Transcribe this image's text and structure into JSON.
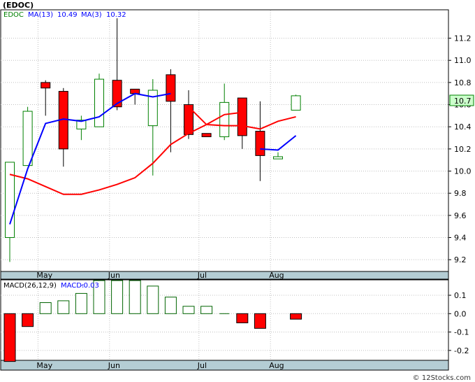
{
  "page": {
    "title": "(EDOC)",
    "footer": "© 12Stocks.com"
  },
  "colors": {
    "up_fill": "#ffffff",
    "up_stroke": "#008000",
    "down_fill": "#ff0000",
    "ma13": "#0000ff",
    "ma3": "#ff0000",
    "macd_pos_stroke": "#006400",
    "macd_neg_fill": "#ff0000",
    "axis_band": "#b4cdd4",
    "last_price_bg": "#ccffcc"
  },
  "chart_data": [
    {
      "type": "candlestick",
      "legend": {
        "ticker": "EDOC",
        "ma13_label": "MA(13)",
        "ma13_value": "10.49",
        "ma3_label": "MA(3)",
        "ma3_value": "10.32"
      },
      "ylim": [
        9.1,
        11.45
      ],
      "yticks": [
        "9.2",
        "9.4",
        "9.6",
        "9.8",
        "10.0",
        "10.2",
        "10.4",
        "10.6",
        "10.8",
        "11.0",
        "11.2"
      ],
      "last_price": "10.7",
      "x_labels": [
        {
          "label": "May",
          "index": 1
        },
        {
          "label": "Jun",
          "index": 5
        },
        {
          "label": "Jul",
          "index": 10
        },
        {
          "label": "Aug",
          "index": 14
        }
      ],
      "candles": [
        {
          "open": 9.4,
          "high": 10.08,
          "low": 9.18,
          "close": 10.08
        },
        {
          "open": 10.05,
          "high": 10.58,
          "low": 10.05,
          "close": 10.54
        },
        {
          "open": 10.8,
          "high": 10.82,
          "low": 10.5,
          "close": 10.75
        },
        {
          "open": 10.72,
          "high": 10.75,
          "low": 10.04,
          "close": 10.2
        },
        {
          "open": 10.38,
          "high": 10.5,
          "low": 10.28,
          "close": 10.46
        },
        {
          "open": 10.4,
          "high": 10.88,
          "low": 10.4,
          "close": 10.83
        },
        {
          "open": 10.82,
          "high": 11.38,
          "low": 10.55,
          "close": 10.58
        },
        {
          "open": 10.74,
          "high": 10.74,
          "low": 10.6,
          "close": 10.7
        },
        {
          "open": 10.41,
          "high": 10.83,
          "low": 9.96,
          "close": 10.73
        },
        {
          "open": 10.87,
          "high": 10.92,
          "low": 10.17,
          "close": 10.63
        },
        {
          "open": 10.6,
          "high": 10.73,
          "low": 10.29,
          "close": 10.33
        },
        {
          "open": 10.34,
          "high": 10.34,
          "low": 10.31,
          "close": 10.31
        },
        {
          "open": 10.31,
          "high": 10.79,
          "low": 10.28,
          "close": 10.62
        },
        {
          "open": 10.66,
          "high": 10.66,
          "low": 10.2,
          "close": 10.32
        },
        {
          "open": 10.36,
          "high": 10.63,
          "low": 9.91,
          "close": 10.14
        },
        {
          "open": 10.11,
          "high": 10.17,
          "low": 10.11,
          "close": 10.13
        },
        {
          "open": 10.55,
          "high": 10.69,
          "low": 10.55,
          "close": 10.68
        }
      ],
      "ma13": [
        9.52,
        10.02,
        10.43,
        10.47,
        10.45,
        10.49,
        10.61,
        10.7,
        10.67,
        10.7,
        null,
        null,
        null,
        null,
        null,
        null,
        null
      ],
      "ma13_tail": [
        null,
        null,
        null,
        null,
        null,
        null,
        null,
        null,
        null,
        null,
        10.58,
        10.42,
        10.41,
        10.41,
        10.38,
        10.45,
        10.49
      ],
      "ma3": [
        9.97,
        9.93,
        9.86,
        9.79,
        9.79,
        9.83,
        9.88,
        9.94,
        10.07,
        10.24,
        10.34,
        10.42,
        10.51,
        10.53,
        null,
        null,
        null
      ],
      "ma3_tail": [
        null,
        null,
        null,
        null,
        null,
        null,
        null,
        null,
        null,
        null,
        null,
        null,
        null,
        null,
        10.2,
        10.19,
        10.32
      ]
    },
    {
      "type": "bar",
      "legend": {
        "label": "MACD(26,12,9)",
        "value_label": "MACD:",
        "value": "-0.03"
      },
      "ylim": [
        -0.25,
        0.18
      ],
      "yticks": [
        "0.1",
        "0.0",
        "-0.1",
        "-0.2"
      ],
      "values": [
        -0.26,
        -0.07,
        0.06,
        0.07,
        0.11,
        0.18,
        0.18,
        0.18,
        0.15,
        0.09,
        0.04,
        0.04,
        0.0,
        -0.05,
        -0.08,
        null,
        -0.03
      ]
    }
  ]
}
